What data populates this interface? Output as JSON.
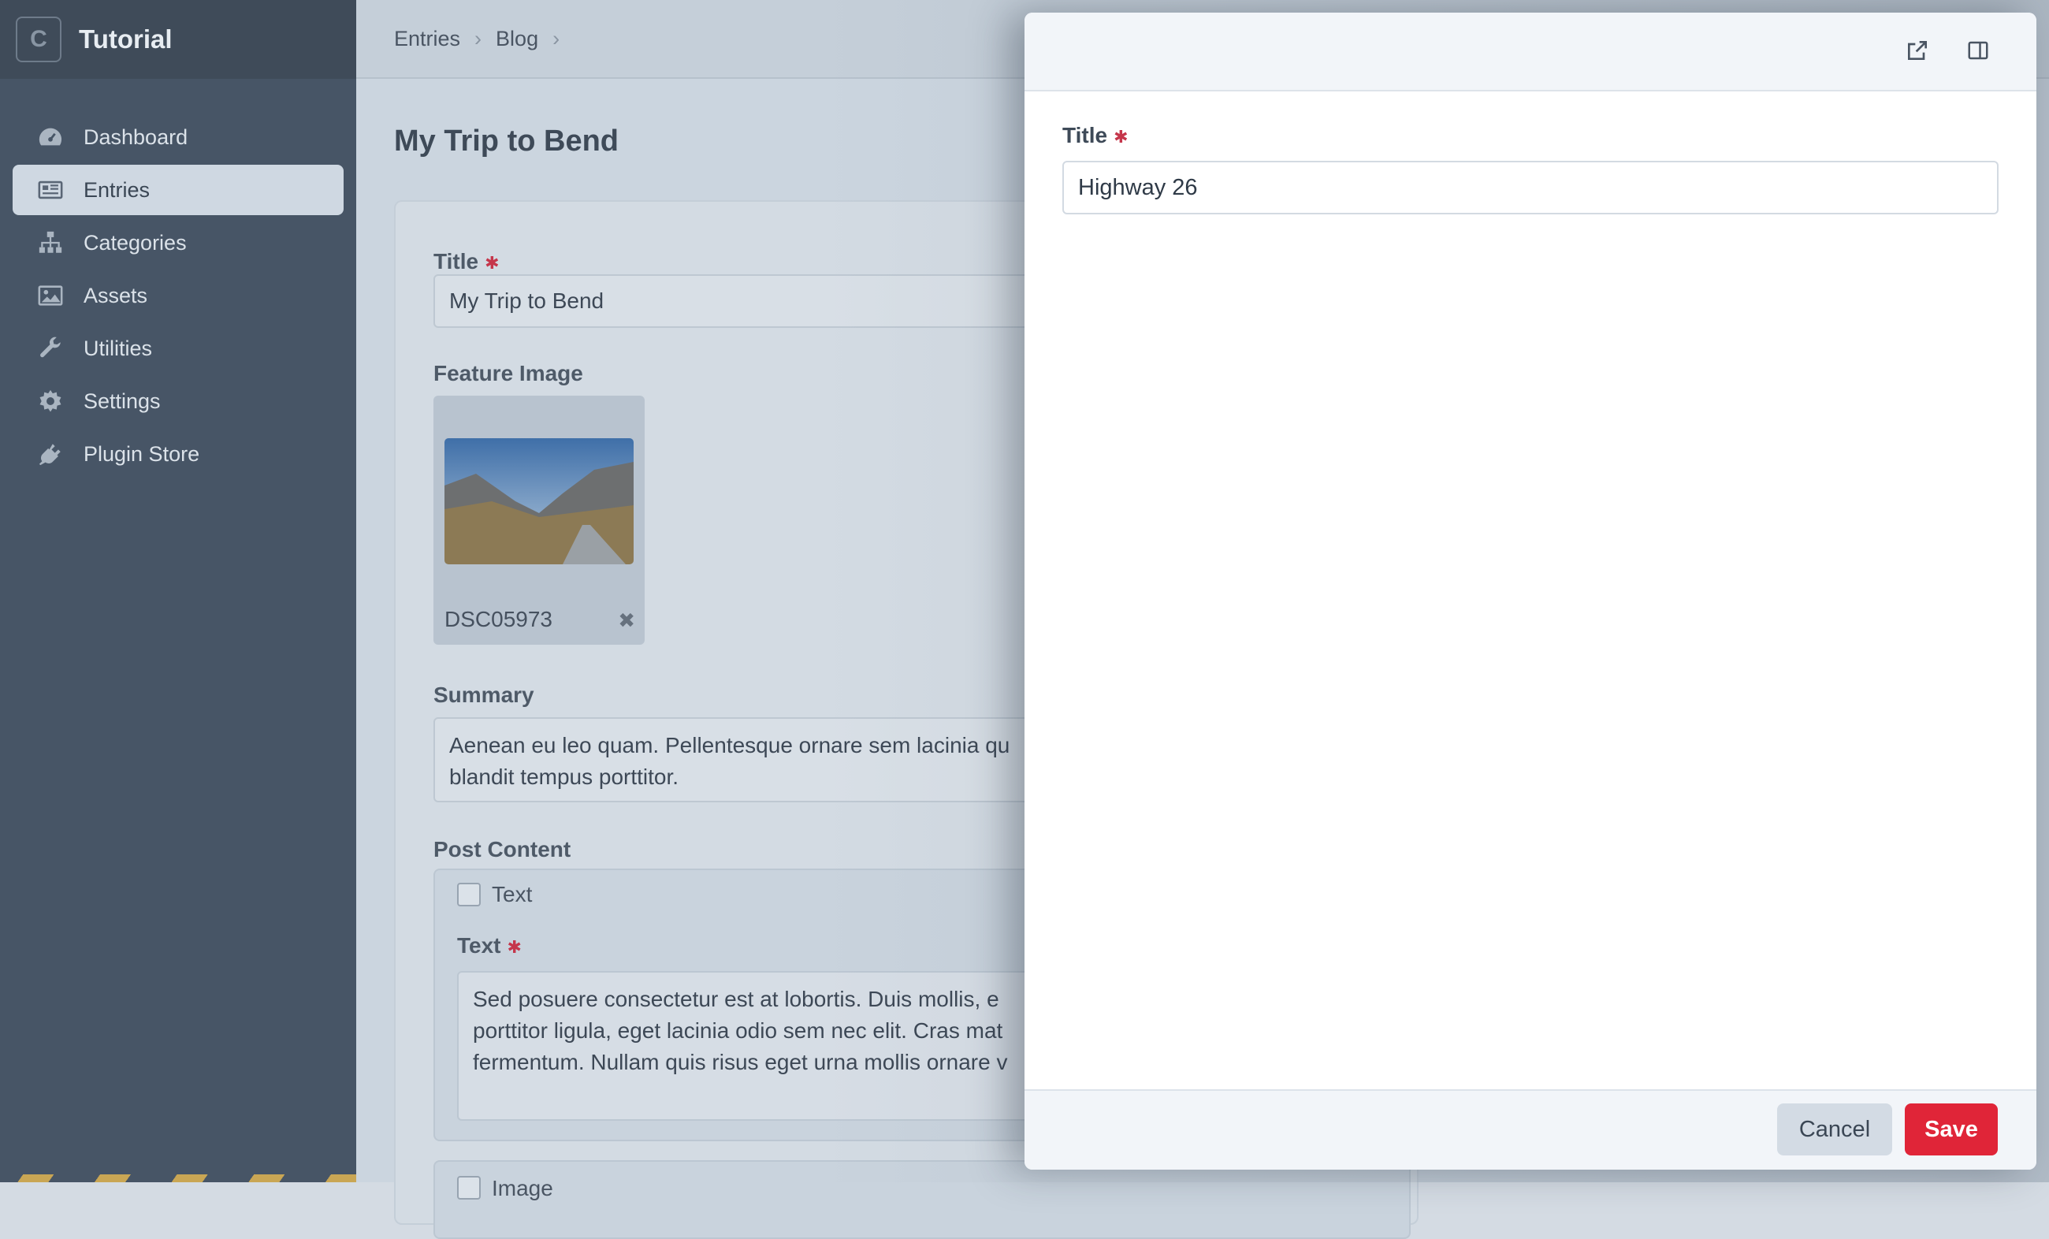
{
  "sidebar": {
    "logo_letter": "C",
    "site_name": "Tutorial",
    "items": [
      {
        "label": "Dashboard",
        "icon": "gauge-icon",
        "active": false
      },
      {
        "label": "Entries",
        "icon": "newspaper-icon",
        "active": true
      },
      {
        "label": "Categories",
        "icon": "sitemap-icon",
        "active": false
      },
      {
        "label": "Assets",
        "icon": "image-icon",
        "active": false
      },
      {
        "label": "Utilities",
        "icon": "wrench-icon",
        "active": false
      },
      {
        "label": "Settings",
        "icon": "gear-icon",
        "active": false
      },
      {
        "label": "Plugin Store",
        "icon": "plug-icon",
        "active": false
      }
    ]
  },
  "breadcrumb": [
    "Entries",
    "Blog"
  ],
  "page": {
    "title": "My Trip to Bend",
    "title_field": {
      "label": "Title",
      "value": "My Trip to Bend"
    },
    "feature_image": {
      "label": "Feature Image",
      "filename": "DSC05973"
    },
    "summary": {
      "label": "Summary",
      "value": "Aenean eu leo quam. Pellentesque ornare sem lacinia qu",
      "value_line2": "blandit tempus porttitor."
    },
    "post_content": {
      "label": "Post Content",
      "block1": {
        "type_label": "Text",
        "field_label": "Text",
        "lines": [
          "Sed posuere consectetur est at lobortis. Duis mollis, e",
          "porttitor ligula, eget lacinia odio sem nec elit. Cras mat",
          "fermentum. Nullam quis risus eget urna mollis ornare v"
        ]
      },
      "block2": {
        "type_label": "Image"
      }
    }
  },
  "slideout": {
    "open_new_tab_icon": "external-link-icon",
    "sidebar_toggle_icon": "sidebar-panel-icon",
    "title_label": "Title",
    "title_value": "Highway 26",
    "cancel_label": "Cancel",
    "save_label": "Save"
  },
  "colors": {
    "sidebar_bg": "#475566",
    "save_red": "#e02538",
    "required_red": "#c5364b"
  }
}
